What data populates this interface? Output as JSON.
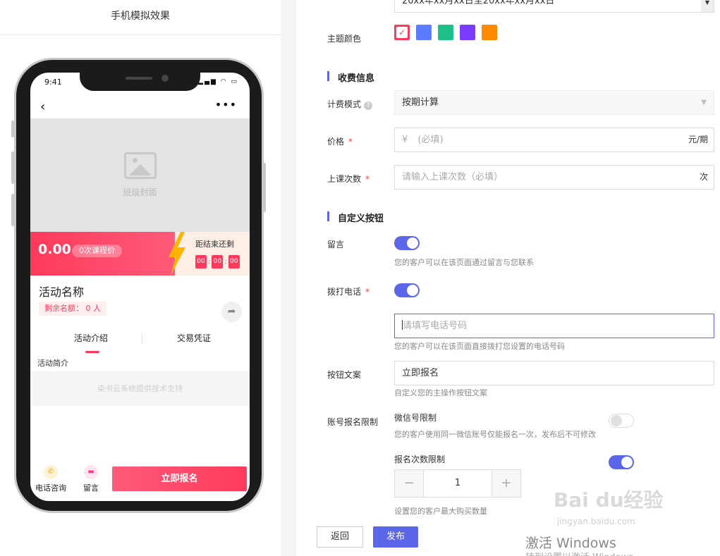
{
  "preview": {
    "title": "手机模拟效果",
    "status_time": "9:41",
    "cover_label": "班级封面",
    "price": "0.00",
    "price_tag": "0次课程价",
    "countdown_label": "距结束还剩",
    "countdown": [
      "00",
      "00",
      "00"
    ],
    "activity_name": "活动名称",
    "quota": "剩余名额： 0 人",
    "tabs": [
      "活动介绍",
      "交易凭证"
    ],
    "intro_label": "活动简介",
    "support": "染书云系统提供技术支持",
    "bottom": {
      "phone": "电话咨询",
      "message": "留言",
      "enroll": "立即报名"
    }
  },
  "form": {
    "date_range": "20xx年xx月xx日至20xx年xx月xx日",
    "theme_color": {
      "label": "主题颜色",
      "colors": [
        "#ff3a5c",
        "#5b7cff",
        "#1dbf8a",
        "#7a3cff",
        "#ff8a00"
      ]
    },
    "fee_section": "收费信息",
    "billing": {
      "label": "计费模式",
      "help": "?",
      "value": "按期计算"
    },
    "price": {
      "label": "价格",
      "required": "*",
      "currency": "¥",
      "placeholder": "(必填)",
      "suffix": "元/期"
    },
    "lessons": {
      "label": "上课次数",
      "required": "*",
      "placeholder": "请输入上课次数（必填）",
      "suffix": "次"
    },
    "custom_section": "自定义按钮",
    "message": {
      "label": "留言",
      "on": true,
      "hint": "您的客户可以在该页面通过留言与您联系"
    },
    "call": {
      "label": "拨打电话",
      "required": "*",
      "on": true,
      "placeholder": "请填写电话号码",
      "hint": "您的客户可以在该页面直接拨打您设置的电话号码"
    },
    "button_text": {
      "label": "按钮文案",
      "value": "立即报名",
      "hint": "自定义您的主操作按钮文案"
    },
    "account_limit": {
      "label": "账号报名限制",
      "wechat_label": "微信号限制",
      "wechat_on": false,
      "wechat_hint": "您的客户使用同一微信账号仅能报名一次，发布后不可修改",
      "count_label": "报名次数限制",
      "count_on": true,
      "count_value": "1",
      "count_hint": "设置您的客户最大购买数量"
    },
    "back": "返回",
    "publish": "发布"
  },
  "overlay": {
    "watermark_logo": "Bai du经验",
    "watermark_url": "jingyan.baidu.com",
    "activate": "激活 Windows",
    "activate_sub": "转到设置以激活 Windows"
  }
}
